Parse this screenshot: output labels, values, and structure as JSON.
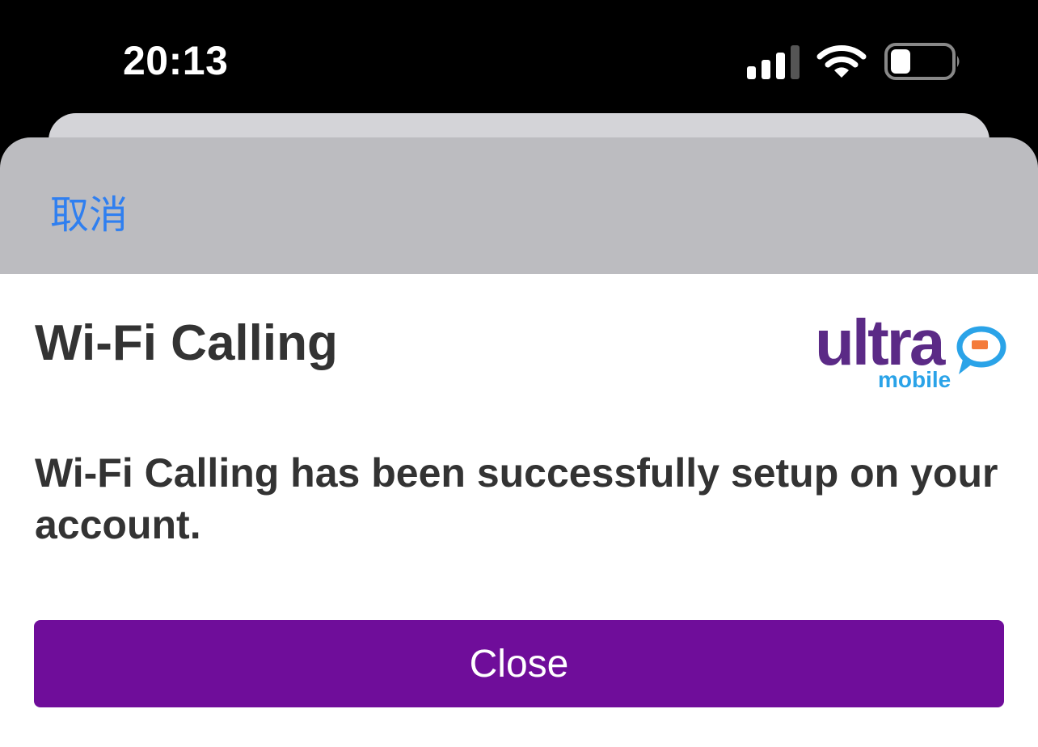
{
  "status_bar": {
    "time": "20:13",
    "signal_icon": "cellular-signal-icon",
    "wifi_icon": "wifi-icon",
    "battery_icon": "battery-icon",
    "battery_level": 0.3
  },
  "sheet": {
    "cancel_label": "取消"
  },
  "page": {
    "title": "Wi-Fi Calling",
    "logo": {
      "wordmark": "ultra",
      "subtitle": "mobile",
      "colors": {
        "wordmark": "#5b2a86",
        "subtitle": "#2aa3e8",
        "bubble": "#2aa3e8",
        "bubble_accent": "#f47b3a"
      }
    },
    "message": "Wi-Fi Calling has been successfully setup on your account.",
    "close_label": "Close"
  },
  "colors": {
    "accent_button": "#6f0d9a",
    "cancel_link": "#2f7ff0",
    "header_bg": "#bcbcc0"
  }
}
